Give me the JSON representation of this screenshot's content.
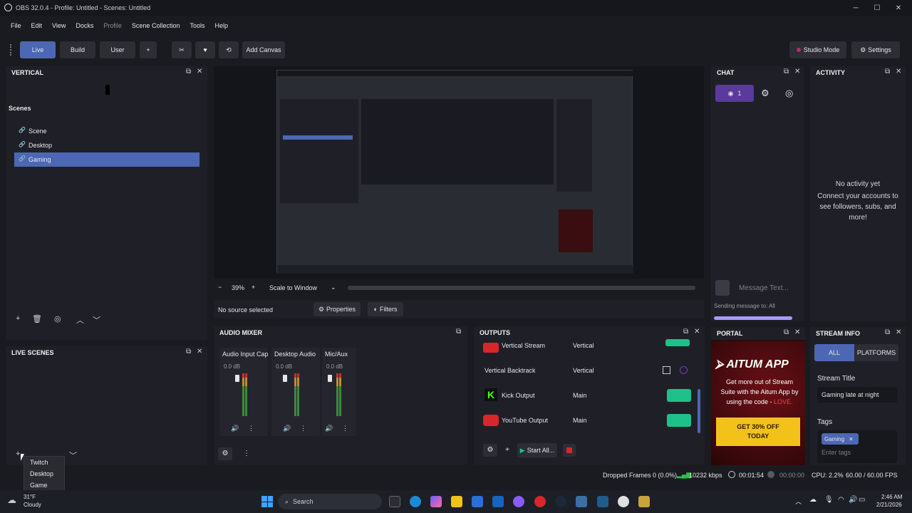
{
  "window": {
    "title": "OBS 32.0.4 - Profile: Untitled - Scenes: Untitled",
    "minimize": "─",
    "maximize": "☐",
    "close": "✕"
  },
  "menu": {
    "file": "File",
    "edit": "Edit",
    "view": "View",
    "docks": "Docks",
    "profile": "Profile",
    "scene_collection": "Scene Collection",
    "tools": "Tools",
    "help": "Help"
  },
  "toolbar": {
    "live": "Live",
    "build": "Build",
    "user": "User",
    "plus": "+",
    "add_canvas": "Add Canvas",
    "studio_mode": "Studio Mode",
    "settings": "Settings"
  },
  "vertical": {
    "title": "VERTICAL",
    "scenes_label": "Scenes",
    "scenes": [
      "Scene",
      "Desktop",
      "Gaming"
    ]
  },
  "live_scenes": {
    "title": "LIVE SCENES",
    "dropdown": [
      "Twitch",
      "Desktop",
      "Game"
    ]
  },
  "preview": {
    "zoom": "39%",
    "scale_mode": "Scale to Window",
    "no_source": "No source selected",
    "properties": "Properties",
    "filters": "Filters",
    "minus": "−",
    "plus": "+"
  },
  "audio_mixer": {
    "title": "AUDIO MIXER",
    "channels": [
      {
        "name": "Audio Input Capt",
        "db": "0.0 dB"
      },
      {
        "name": "Desktop Audio",
        "db": "0.0 dB"
      },
      {
        "name": "Mic/Aux",
        "db": "0.0 dB"
      }
    ]
  },
  "outputs": {
    "title": "OUTPUTS",
    "rows": [
      {
        "name": "Vertical Stream",
        "canvas": "Vertical"
      },
      {
        "name": "Vertical Backtrack",
        "canvas": "Vertical"
      },
      {
        "name": "Kick Output",
        "canvas": "Main"
      },
      {
        "name": "YouTube Output",
        "canvas": "Main"
      }
    ],
    "start_all": "Start All..."
  },
  "chat": {
    "title": "CHAT",
    "viewers": "1",
    "placeholder": "Message Text...",
    "sending_to": "Sending message to: All"
  },
  "activity": {
    "title": "ACTIVITY",
    "empty_title": "No activity yet",
    "empty_body": "Connect your accounts to see followers, subs, and more!"
  },
  "portal": {
    "title": "PORTAL",
    "brand": "AITUM APP",
    "promo_text": "Get more out of Stream Suite with the Aitum App by using the code -",
    "code": "LOVE.",
    "cta": "GET 30% OFF TODAY"
  },
  "stream_info": {
    "title": "STREAM INFO",
    "tab_all": "ALL",
    "tab_platforms": "PLATFORMS",
    "stream_title_label": "Stream Title",
    "stream_title_value": "Gaming late at night",
    "tags_label": "Tags",
    "tags": [
      "Gaming"
    ],
    "tags_placeholder": "Enter tags"
  },
  "status": {
    "dropped_frames": "Dropped Frames 0 (0.0%)",
    "bitrate": "10232 kbps",
    "stream_time": "00:01:54",
    "rec_time": "00:00:00",
    "cpu": "CPU: 2.2%",
    "fps": "60.00 / 60.00 FPS"
  },
  "taskbar": {
    "temp": "31°F",
    "weather": "Cloudy",
    "search": "Search",
    "time": "2:46 AM",
    "date": "2/21/2026"
  },
  "colors": {
    "accent": "#4c68b4",
    "green": "#1fc18a",
    "purple": "#5a3a9c",
    "gold": "#f2c21b",
    "red": "#d8262a"
  }
}
